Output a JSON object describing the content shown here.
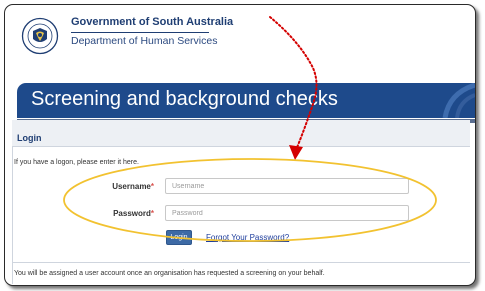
{
  "header": {
    "gov_title": "Government of South Australia",
    "dept_title": "Department of Human Services",
    "logo_icon": "south-australia-crest"
  },
  "banner": {
    "title": "Screening and background checks",
    "color": "#1e4a8b"
  },
  "login": {
    "section_title": "Login",
    "intro": "If you have a logon, please enter it here.",
    "username": {
      "label": "Username",
      "required_mark": "*",
      "placeholder": "Username",
      "value": ""
    },
    "password": {
      "label": "Password",
      "required_mark": "*",
      "placeholder": "Password",
      "value": ""
    },
    "login_button": "Login",
    "forgot_link": "Forgot Your Password?"
  },
  "footer": {
    "note": "You will be assigned a user account once an organisation has requested a screening on your behalf."
  },
  "annotation": {
    "arrow_color": "#d40000",
    "highlight_color": "#f2c230"
  }
}
